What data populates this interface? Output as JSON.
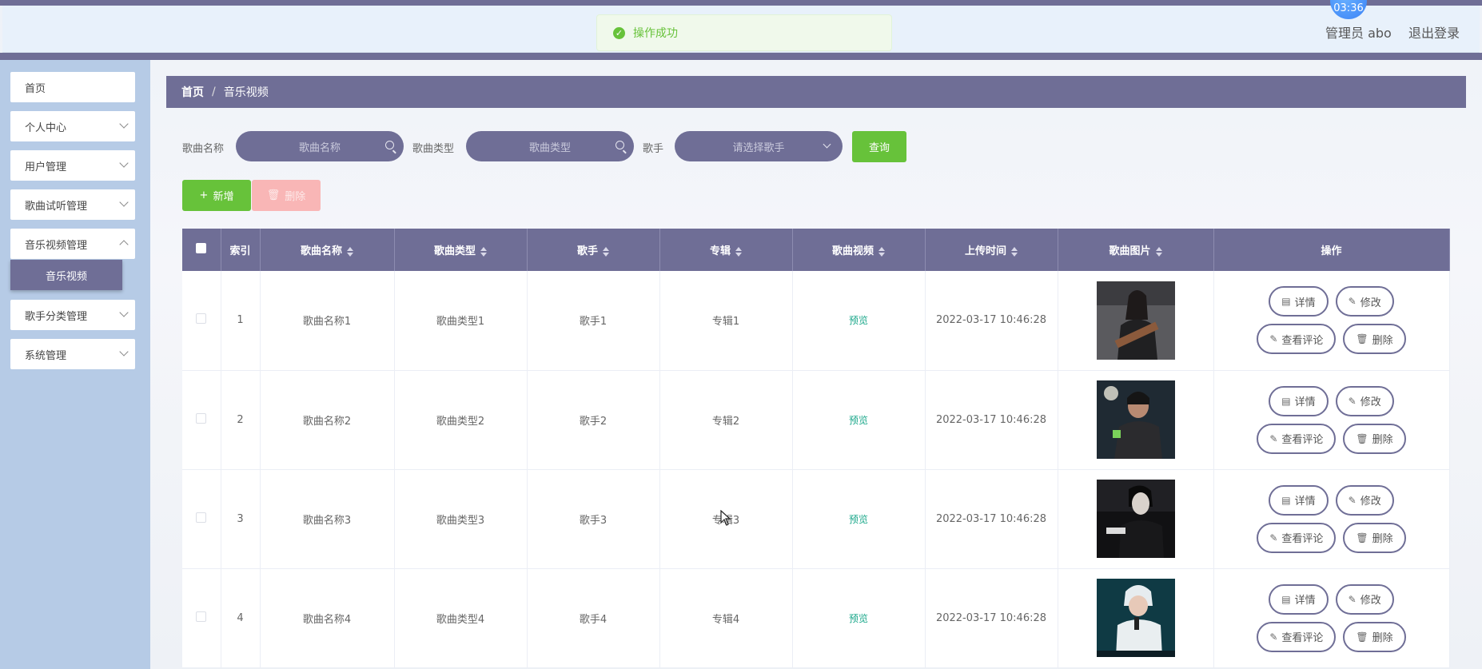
{
  "header": {
    "clock": "03:36",
    "admin_label": "管理员 abo",
    "logout_label": "退出登录"
  },
  "toast": {
    "message": "操作成功"
  },
  "sidebar": {
    "items": [
      {
        "label": "首页"
      },
      {
        "label": "个人中心"
      },
      {
        "label": "用户管理"
      },
      {
        "label": "歌曲试听管理"
      },
      {
        "label": "音乐视频管理"
      },
      {
        "label": "歌手分类管理"
      },
      {
        "label": "系统管理"
      }
    ],
    "active_sub": "音乐视频"
  },
  "breadcrumb": {
    "home": "首页",
    "current": "音乐视频"
  },
  "filters": {
    "song_name_label": "歌曲名称",
    "song_name_placeholder": "歌曲名称",
    "song_type_label": "歌曲类型",
    "song_type_placeholder": "歌曲类型",
    "singer_label": "歌手",
    "singer_placeholder": "请选择歌手",
    "query_label": "查询"
  },
  "toolbar": {
    "add_label": "新增",
    "delete_label": "删除"
  },
  "table": {
    "headers": [
      "索引",
      "歌曲名称",
      "歌曲类型",
      "歌手",
      "专辑",
      "歌曲视频",
      "上传时间",
      "歌曲图片",
      "操作"
    ],
    "rows": [
      {
        "index": "1",
        "name": "歌曲名称1",
        "type": "歌曲类型1",
        "singer": "歌手1",
        "album": "专辑1",
        "video": "预览",
        "time": "2022-03-17 10:46:28"
      },
      {
        "index": "2",
        "name": "歌曲名称2",
        "type": "歌曲类型2",
        "singer": "歌手2",
        "album": "专辑2",
        "video": "预览",
        "time": "2022-03-17 10:46:28"
      },
      {
        "index": "3",
        "name": "歌曲名称3",
        "type": "歌曲类型3",
        "singer": "歌手3",
        "album": "专辑3",
        "video": "预览",
        "time": "2022-03-17 10:46:28"
      },
      {
        "index": "4",
        "name": "歌曲名称4",
        "type": "歌曲类型4",
        "singer": "歌手4",
        "album": "专辑4",
        "video": "预览",
        "time": "2022-03-17 10:46:28"
      }
    ],
    "ops": {
      "detail": "详情",
      "edit": "修改",
      "comments": "查看评论",
      "delete": "删除"
    }
  },
  "colors": {
    "primary": "#6f6e96",
    "success": "#67c23a",
    "danger_light": "#f9b6b6",
    "sidebar_bg": "#b6cbe6",
    "preview_link": "#1aa78a"
  }
}
